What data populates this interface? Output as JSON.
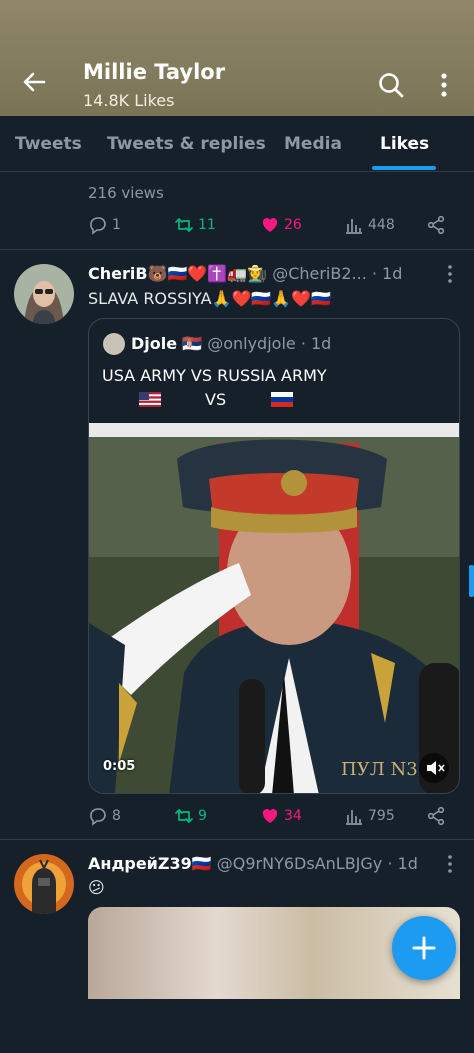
{
  "header": {
    "title": "Millie Taylor",
    "subtitle": "14.8K Likes"
  },
  "tabs": [
    "Tweets",
    "Tweets & replies",
    "Media",
    "Likes"
  ],
  "tweet1": {
    "views": "216 views",
    "replies": "1",
    "retweets": "11",
    "likes": "26",
    "view_count": "448"
  },
  "tweet2": {
    "name": "CheriB🐻🇷🇺❤️✝️🚛👩‍🌾",
    "handle": "@CheriB2...",
    "time": "· 1d",
    "text": "SLAVA ROSSIYA🙏❤️🇷🇺🙏❤️🇷🇺",
    "quote": {
      "name": "Djole",
      "name_flag": "🇷🇸",
      "handle": "@onlydjole",
      "time": "· 1d",
      "line1": "USA ARMY  VS  RUSSIA ARMY",
      "line2_mid": "VS",
      "video_time": "0:05",
      "watermark": "ПУЛ N3"
    },
    "replies": "8",
    "retweets": "9",
    "likes": "34",
    "view_count": "795"
  },
  "tweet3": {
    "name": "АндрейZ39🇷🇺",
    "handle": "@Q9rNY6DsAnLBJGy",
    "time": "· 1d",
    "text": "😕"
  },
  "colors": {
    "accent": "#1d9bf0",
    "retweet": "#00ba7c",
    "like": "#f91880",
    "bg": "#15202b"
  }
}
